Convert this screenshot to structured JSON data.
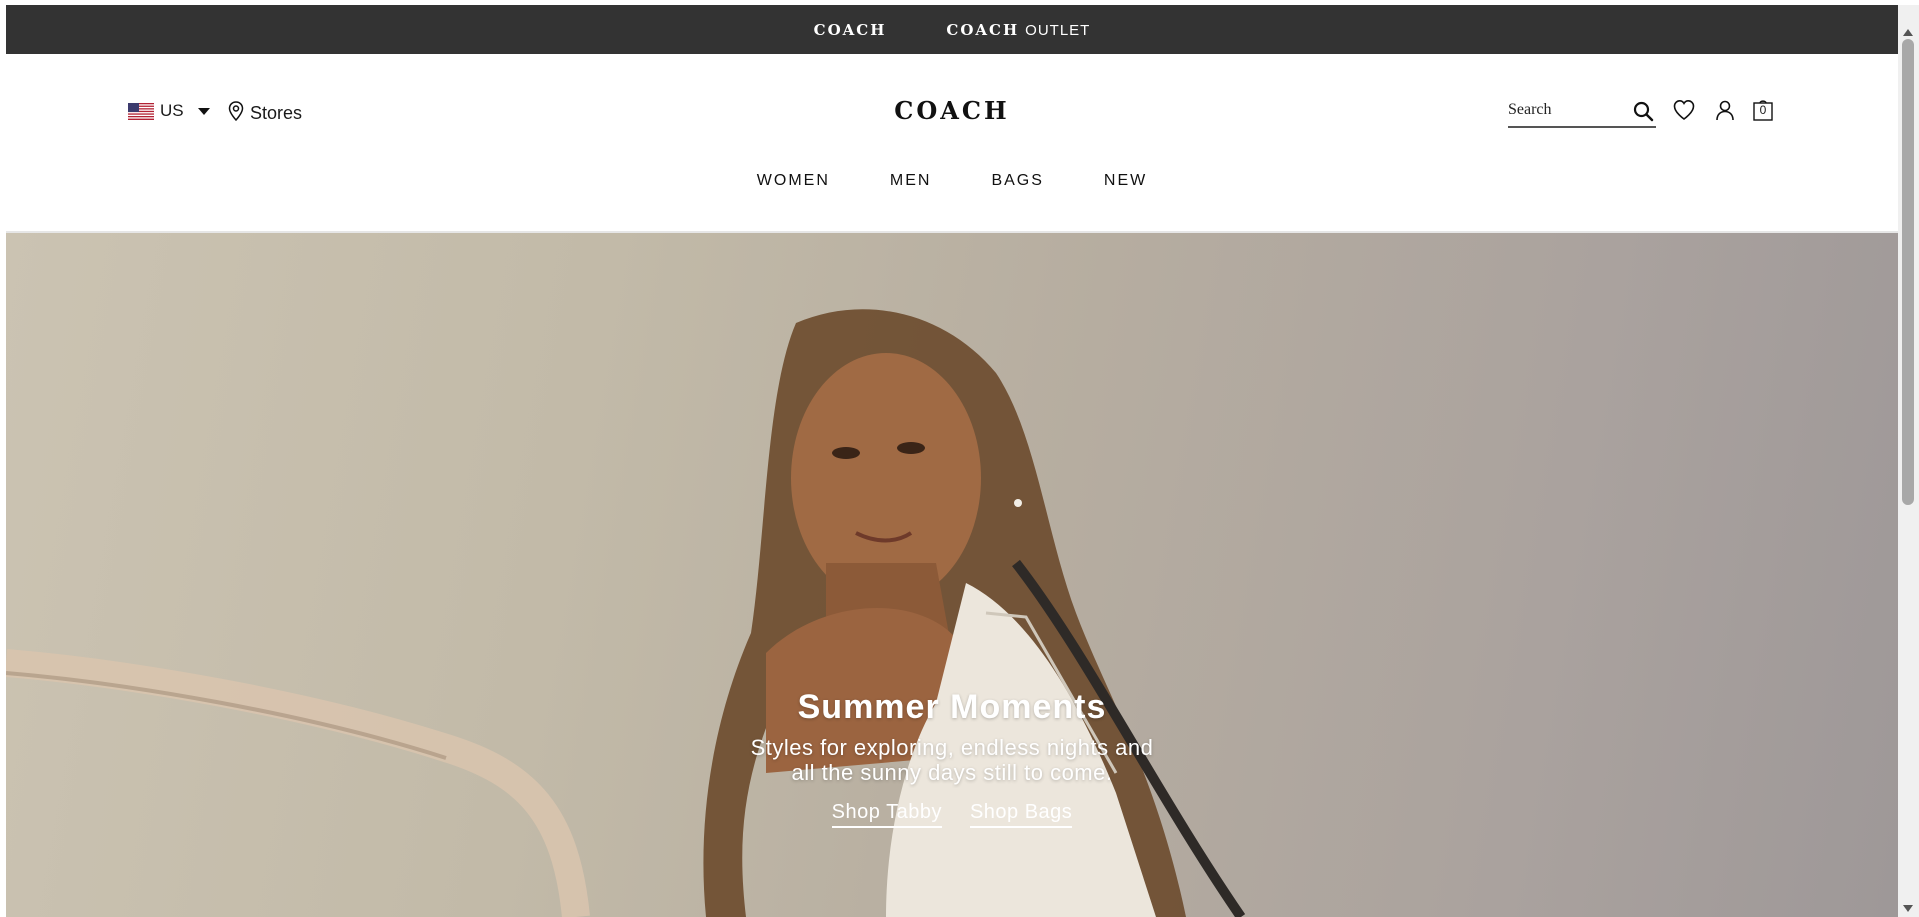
{
  "topbar": {
    "coach_label": "COACH",
    "outlet_wordmark": "COACH",
    "outlet_suffix": "OUTLET"
  },
  "header": {
    "country": "US",
    "stores_label": "Stores",
    "logo": "COACH",
    "search_placeholder": "Search",
    "bag_count": "0",
    "icons": [
      "flag-us-icon",
      "chevron-down-icon",
      "location-pin-icon",
      "search-icon",
      "heart-icon",
      "user-icon",
      "bag-icon"
    ]
  },
  "nav": {
    "items": [
      {
        "label": "WOMEN"
      },
      {
        "label": "MEN"
      },
      {
        "label": "BAGS"
      },
      {
        "label": "NEW"
      }
    ]
  },
  "hero": {
    "title": "Summer Moments",
    "subtitle_line1": "Styles for exploring, endless nights and",
    "subtitle_line2": "all the sunny days still to come.",
    "cta_primary": "Shop Tabby",
    "cta_secondary": "Shop Bags"
  },
  "colors": {
    "topbar_bg": "#333333",
    "text": "#111111",
    "hero_bg": "#c2baa8",
    "hero_text": "#ffffff"
  }
}
